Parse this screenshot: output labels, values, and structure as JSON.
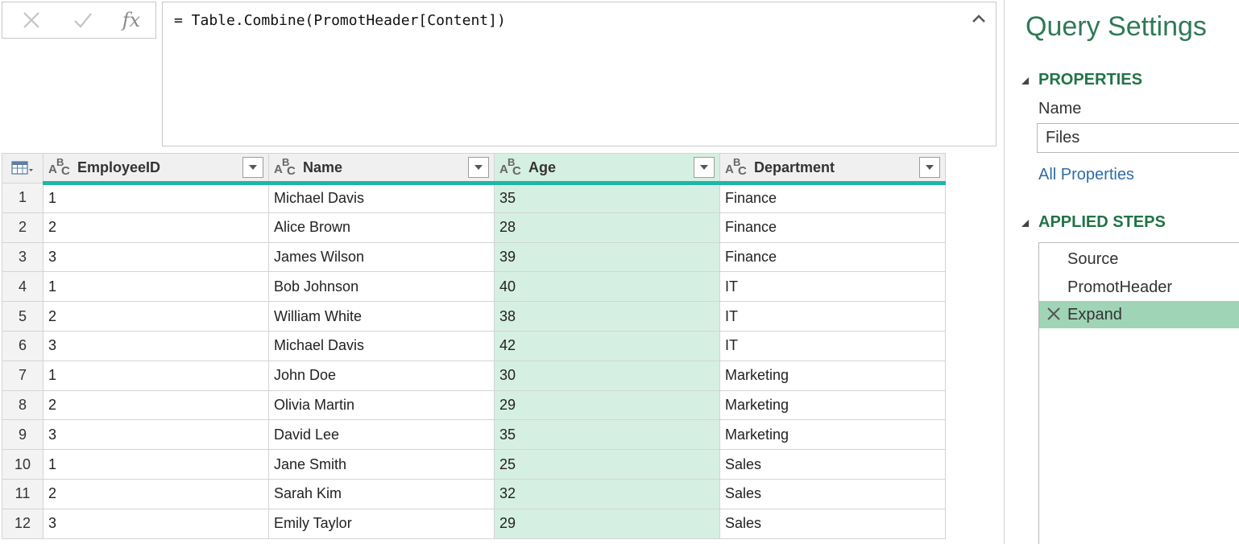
{
  "formula_bar": {
    "cancel_icon": "close-icon",
    "commit_icon": "check-icon",
    "fx_label": "fx",
    "formula": "= Table.Combine(PromotHeader[Content])"
  },
  "grid": {
    "columns": [
      {
        "name": "EmployeeID",
        "type": "text"
      },
      {
        "name": "Name",
        "type": "text"
      },
      {
        "name": "Age",
        "type": "text"
      },
      {
        "name": "Department",
        "type": "text"
      }
    ],
    "selected_column": "Age",
    "accent_color": "#1fb6a6",
    "rows": [
      {
        "n": "1",
        "id": "1",
        "name": "Michael Davis",
        "age": "35",
        "dept": "Finance"
      },
      {
        "n": "2",
        "id": "2",
        "name": "Alice Brown",
        "age": "28",
        "dept": "Finance"
      },
      {
        "n": "3",
        "id": "3",
        "name": "James Wilson",
        "age": "39",
        "dept": "Finance"
      },
      {
        "n": "4",
        "id": "1",
        "name": "Bob Johnson",
        "age": "40",
        "dept": "IT"
      },
      {
        "n": "5",
        "id": "2",
        "name": "William White",
        "age": "38",
        "dept": "IT"
      },
      {
        "n": "6",
        "id": "3",
        "name": "Michael Davis",
        "age": "42",
        "dept": "IT"
      },
      {
        "n": "7",
        "id": "1",
        "name": "John Doe",
        "age": "30",
        "dept": "Marketing"
      },
      {
        "n": "8",
        "id": "2",
        "name": "Olivia Martin",
        "age": "29",
        "dept": "Marketing"
      },
      {
        "n": "9",
        "id": "3",
        "name": "David Lee",
        "age": "35",
        "dept": "Marketing"
      },
      {
        "n": "10",
        "id": "1",
        "name": "Jane Smith",
        "age": "25",
        "dept": "Sales"
      },
      {
        "n": "11",
        "id": "2",
        "name": "Sarah Kim",
        "age": "32",
        "dept": "Sales"
      },
      {
        "n": "12",
        "id": "3",
        "name": "Emily Taylor",
        "age": "29",
        "dept": "Sales"
      }
    ]
  },
  "query_settings": {
    "title": "Query Settings",
    "properties_heading": "PROPERTIES",
    "name_label": "Name",
    "name_value": "Files",
    "all_properties_link": "All Properties",
    "applied_steps_heading": "APPLIED STEPS",
    "steps": [
      {
        "label": "Source",
        "active": false
      },
      {
        "label": "PromotHeader",
        "active": false
      },
      {
        "label": "Expand",
        "active": true
      }
    ],
    "title_color": "#2d7a55",
    "heading_color": "#217346",
    "active_step_color": "#9fd4b6"
  }
}
